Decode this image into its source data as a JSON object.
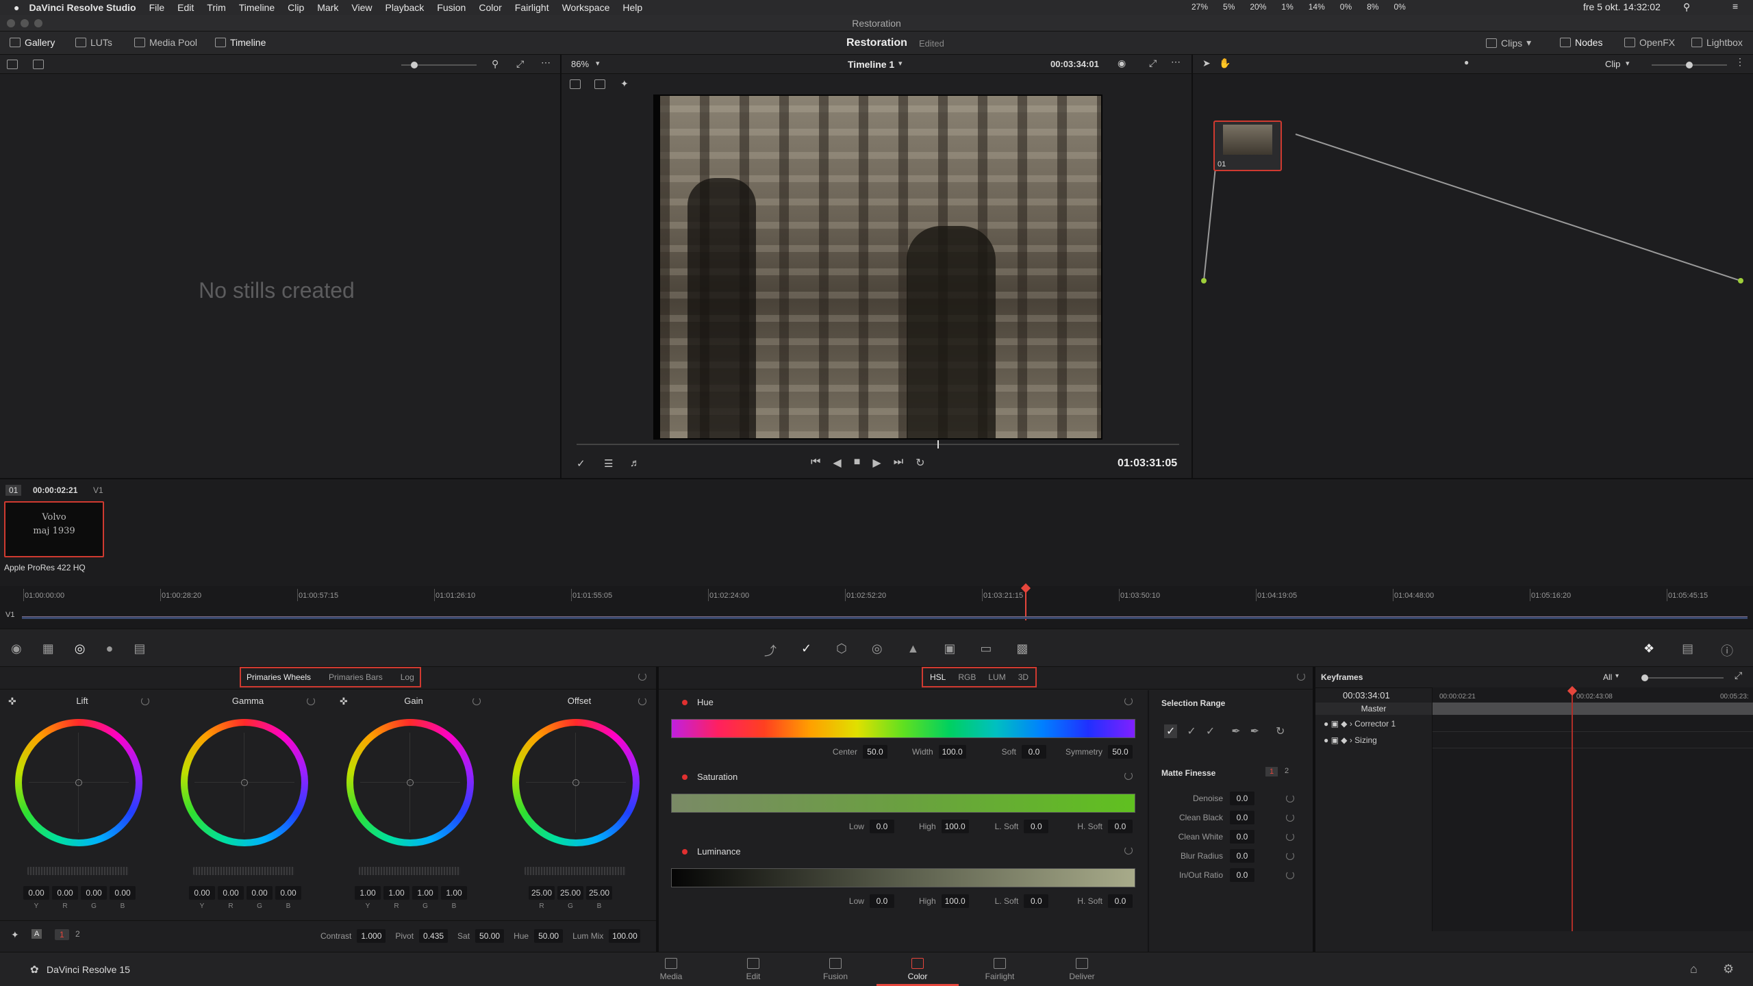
{
  "menubar": {
    "app": "DaVinci Resolve Studio",
    "items": [
      "File",
      "Edit",
      "Trim",
      "Timeline",
      "Clip",
      "Mark",
      "View",
      "Playback",
      "Fusion",
      "Color",
      "Fairlight",
      "Workspace",
      "Help"
    ],
    "status": [
      "27%",
      "5%",
      "20%",
      "1%",
      "14%",
      "0%",
      "8%",
      "0%"
    ],
    "datetime": "fre 5 okt.  14:32:02"
  },
  "window": {
    "title": "Restoration"
  },
  "toolbar": {
    "gallery": "Gallery",
    "luts": "LUTs",
    "media_pool": "Media Pool",
    "timeline": "Timeline",
    "project": "Restoration",
    "project_state": "Edited",
    "clips": "Clips",
    "nodes": "Nodes",
    "openfx": "OpenFX",
    "lightbox": "Lightbox"
  },
  "gallery": {
    "empty": "No stills created"
  },
  "viewer": {
    "zoom": "86%",
    "timeline_name": "Timeline 1",
    "timecode_top": "00:03:34:01",
    "timecode": "01:03:31:05"
  },
  "nodes": {
    "mode": "Clip",
    "node_label": "01"
  },
  "clip": {
    "index": "01",
    "timecode": "00:00:02:21",
    "track": "V1",
    "thumb_line1": "Volvo",
    "thumb_line2": "maj 1939",
    "codec": "Apple ProRes 422 HQ"
  },
  "timeline": {
    "ticks": [
      "01:00:00:00",
      "01:00:28:20",
      "01:00:57:15",
      "01:01:26:10",
      "01:01:55:05",
      "01:02:24:00",
      "01:02:52:20",
      "01:03:21:15",
      "01:03:50:10",
      "01:04:19:05",
      "01:04:48:00",
      "01:05:16:20",
      "01:05:45:15"
    ],
    "track": "V1"
  },
  "primaries": {
    "tabs": [
      "Primaries Wheels",
      "Primaries Bars",
      "Log"
    ],
    "wheels": [
      {
        "name": "Lift",
        "values": [
          "0.00",
          "0.00",
          "0.00",
          "0.00"
        ],
        "labels": [
          "Y",
          "R",
          "G",
          "B"
        ]
      },
      {
        "name": "Gamma",
        "values": [
          "0.00",
          "0.00",
          "0.00",
          "0.00"
        ],
        "labels": [
          "Y",
          "R",
          "G",
          "B"
        ]
      },
      {
        "name": "Gain",
        "values": [
          "1.00",
          "1.00",
          "1.00",
          "1.00"
        ],
        "labels": [
          "Y",
          "R",
          "G",
          "B"
        ]
      },
      {
        "name": "Offset",
        "values": [
          "25.00",
          "25.00",
          "25.00"
        ],
        "labels": [
          "R",
          "G",
          "B"
        ]
      }
    ],
    "bottom": {
      "page1": "1",
      "page2": "2",
      "contrast_label": "Contrast",
      "contrast": "1.000",
      "pivot_label": "Pivot",
      "pivot": "0.435",
      "sat_label": "Sat",
      "sat": "50.00",
      "hue_label": "Hue",
      "hue": "50.00",
      "lummix_label": "Lum Mix",
      "lummix": "100.00",
      "a_label": "A"
    }
  },
  "qualifier": {
    "tabs": [
      "HSL",
      "RGB",
      "LUM",
      "3D"
    ],
    "hue": {
      "title": "Hue",
      "center_label": "Center",
      "center": "50.0",
      "width_label": "Width",
      "width": "100.0",
      "soft_label": "Soft",
      "soft": "0.0",
      "symmetry_label": "Symmetry",
      "symmetry": "50.0"
    },
    "saturation": {
      "title": "Saturation",
      "low_label": "Low",
      "low": "0.0",
      "high_label": "High",
      "high": "100.0",
      "lsoft_label": "L. Soft",
      "lsoft": "0.0",
      "hsoft_label": "H. Soft",
      "hsoft": "0.0"
    },
    "luminance": {
      "title": "Luminance",
      "low_label": "Low",
      "low": "0.0",
      "high_label": "High",
      "high": "100.0",
      "lsoft_label": "L. Soft",
      "lsoft": "0.0",
      "hsoft_label": "H. Soft",
      "hsoft": "0.0"
    },
    "selection_range": "Selection Range",
    "matte": {
      "title": "Matte Finesse",
      "p1": "1",
      "p2": "2",
      "rows": [
        {
          "label": "Denoise",
          "value": "0.0"
        },
        {
          "label": "Clean Black",
          "value": "0.0"
        },
        {
          "label": "Clean White",
          "value": "0.0"
        },
        {
          "label": "Blur Radius",
          "value": "0.0"
        },
        {
          "label": "In/Out Ratio",
          "value": "0.0"
        }
      ]
    }
  },
  "keyframes": {
    "title": "Keyframes",
    "filter": "All",
    "timecode": "00:03:34:01",
    "ticks": [
      "00:00:02:21",
      "00:02:43:08",
      "00:05:23:"
    ],
    "master": "Master",
    "tracks": [
      "Corrector 1",
      "Sizing"
    ]
  },
  "footer": {
    "app": "DaVinci Resolve 15",
    "pages": [
      "Media",
      "Edit",
      "Fusion",
      "Color",
      "Fairlight",
      "Deliver"
    ],
    "active": "Color"
  },
  "colors": {
    "accent": "#e6463c",
    "active_page": "#e6463c",
    "highlight_box": "#d03a30"
  }
}
